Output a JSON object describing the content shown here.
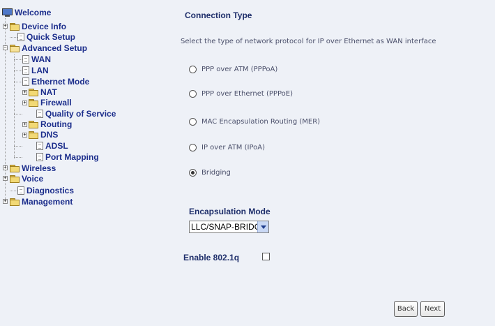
{
  "tree": {
    "welcome": "Welcome",
    "device_info": "Device Info",
    "quick_setup": "Quick Setup",
    "advanced_setup": "Advanced Setup",
    "wan": "WAN",
    "lan": "LAN",
    "ethernet_mode": "Ethernet Mode",
    "nat": "NAT",
    "firewall": "Firewall",
    "qos": "Quality of Service",
    "routing": "Routing",
    "dns": "DNS",
    "adsl": "ADSL",
    "port_mapping": "Port Mapping",
    "wireless": "Wireless",
    "voice": "Voice",
    "diagnostics": "Diagnostics",
    "management": "Management"
  },
  "main": {
    "title": "Connection Type",
    "description": "Select the type of network protocol for IP over Ethernet as WAN interface",
    "options": [
      {
        "label": "PPP over ATM (PPPoA)",
        "selected": false
      },
      {
        "label": "PPP over Ethernet (PPPoE)",
        "selected": false
      },
      {
        "label": "MAC Encapsulation Routing (MER)",
        "selected": false
      },
      {
        "label": "IP over ATM (IPoA)",
        "selected": false
      },
      {
        "label": "Bridging",
        "selected": true
      }
    ],
    "encapsulation_title": "Encapsulation Mode",
    "encapsulation_value": "LLC/SNAP-BRIDGING",
    "enable_8021q_label": "Enable 802.1q",
    "enable_8021q_checked": false,
    "back_label": "Back",
    "next_label": "Next"
  },
  "icons": {
    "welcome": "monitor-icon",
    "folder": "folder-icon",
    "page": "page-icon",
    "expand": "plus-box",
    "collapse": "minus-box"
  }
}
